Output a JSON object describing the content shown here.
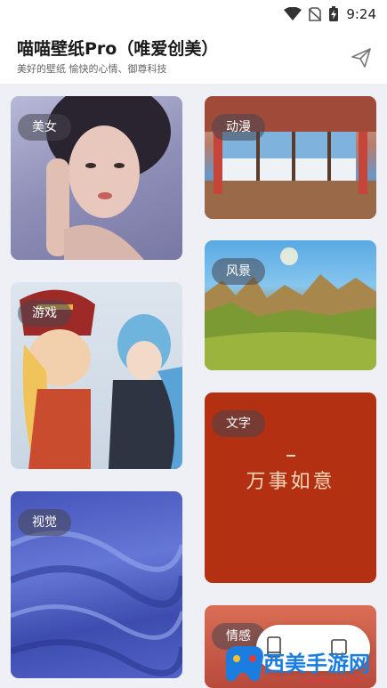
{
  "status_bar": {
    "time": "9:24"
  },
  "header": {
    "title": "喵喵壁纸Pro（唯爱创美）",
    "subtitle": "美好的壁纸 愉快的心情、御尊科技"
  },
  "categories": [
    {
      "label": "美女"
    },
    {
      "label": "动漫"
    },
    {
      "label": "风景"
    },
    {
      "label": "游戏"
    },
    {
      "label": "文字",
      "artwork_text": "万事如意"
    },
    {
      "label": "视觉"
    },
    {
      "label": "情感"
    }
  ],
  "watermark": {
    "text": "西美手游网",
    "url": "hanxm.com"
  },
  "colors": {
    "accent": "#1b7de0",
    "tag_bg": "rgba(70,70,80,0.55)",
    "text_card": "#b43012"
  }
}
